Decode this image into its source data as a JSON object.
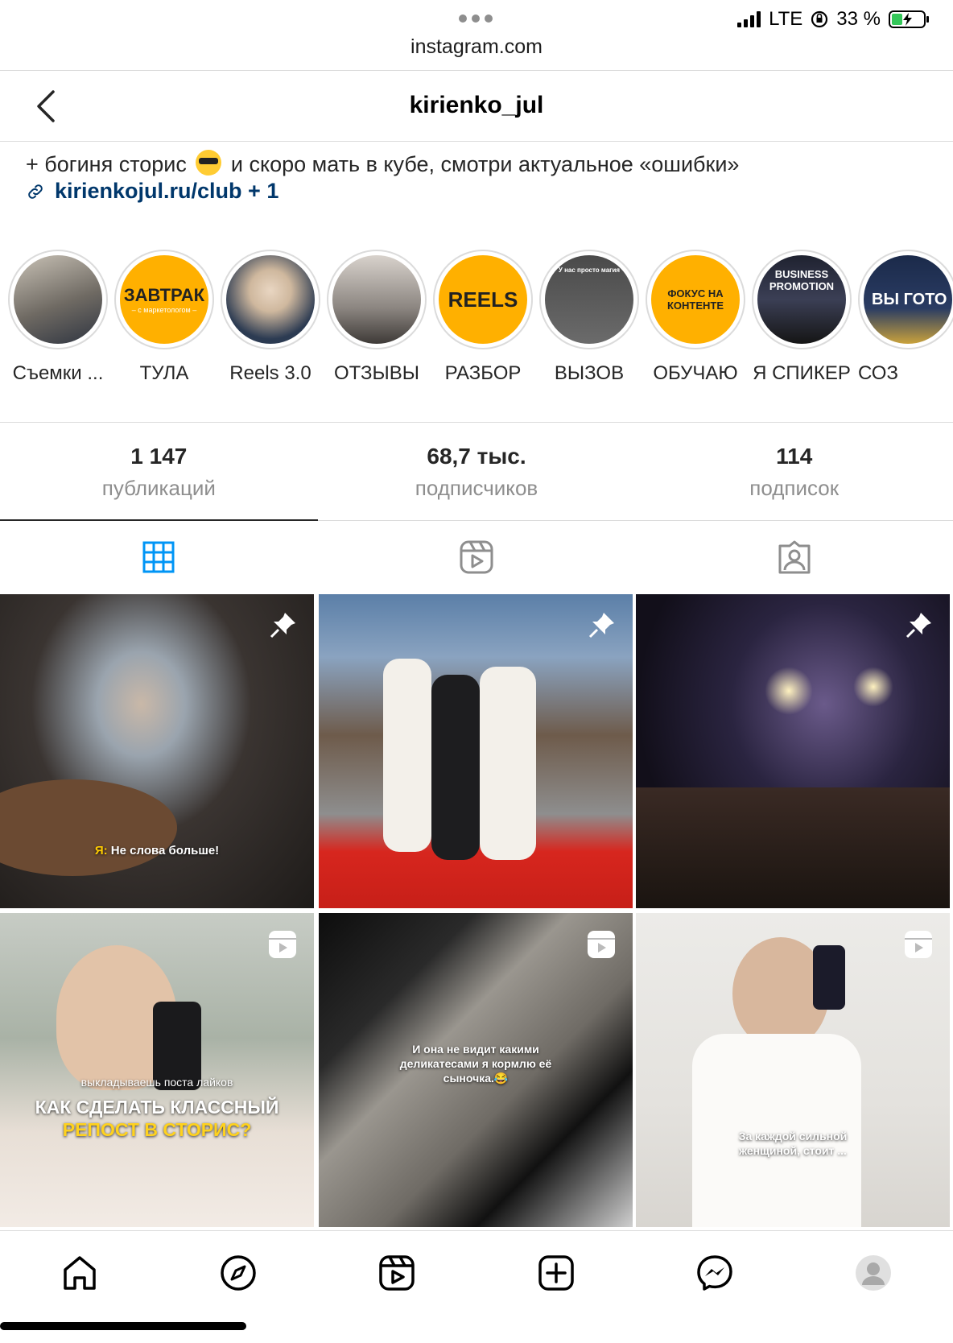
{
  "status": {
    "carrier": "LTE",
    "battery": "33 %",
    "battery_level": 0.33
  },
  "browser": {
    "url": "instagram.com"
  },
  "header": {
    "username": "kirienko_jul"
  },
  "bio": {
    "line": "+ богиня сторис",
    "line_after_emoji": "и скоро мать в кубе, смотри актуальное «ошибки»",
    "link": "kirienkojul.ru/club + 1"
  },
  "highlights": [
    {
      "label": "Съемки ...",
      "cover_text": ""
    },
    {
      "label": "ТУЛА",
      "cover_text": "ЗАВТРАК",
      "cover_sub": "– с маркетологом –"
    },
    {
      "label": "Reels 3.0",
      "cover_text": ""
    },
    {
      "label": "ОТЗЫВЫ",
      "cover_text": ""
    },
    {
      "label": "РАЗБОР",
      "cover_text": "REELS"
    },
    {
      "label": "ВЫЗОВ",
      "cover_text": "У нас просто магия"
    },
    {
      "label": "ОБУЧАЮ",
      "cover_text": "ФОКУС НА КОНТЕНТЕ"
    },
    {
      "label": "Я СПИКЕР",
      "cover_text": "BUSINESS PROMOTION"
    },
    {
      "label": "СОЗ",
      "cover_text": "ВЫ ГОТО"
    }
  ],
  "stats": [
    {
      "value": "1 147",
      "label": "публикаций"
    },
    {
      "value": "68,7 тыс.",
      "label": "подписчиков"
    },
    {
      "value": "114",
      "label": "подписок"
    }
  ],
  "tabs": [
    "grid-icon",
    "reels-icon",
    "tagged-icon"
  ],
  "posts": [
    {
      "type": "pinned",
      "caption": "Я: Не слова больше!",
      "caption_highlight": "Я:"
    },
    {
      "type": "pinned",
      "caption": ""
    },
    {
      "type": "pinned",
      "caption": ""
    },
    {
      "type": "reel",
      "caption": "выкладываешь поста лайков",
      "headline": "КАК СДЕЛАТЬ КЛАССНЫЙ",
      "headline2": "РЕПОСТ В СТОРИС?"
    },
    {
      "type": "reel",
      "caption": "И она не видит какими деликатесами я кормлю её сыночка.😂"
    },
    {
      "type": "reel",
      "caption": "За каждой сильной женщиной, стоит ..."
    }
  ],
  "nav": [
    "home-icon",
    "explore-icon",
    "reels-icon",
    "create-icon",
    "messenger-icon",
    "profile-avatar"
  ],
  "colors": {
    "link": "#00376b",
    "accent": "#0095f6",
    "highlight_yellow": "#ffb000"
  }
}
